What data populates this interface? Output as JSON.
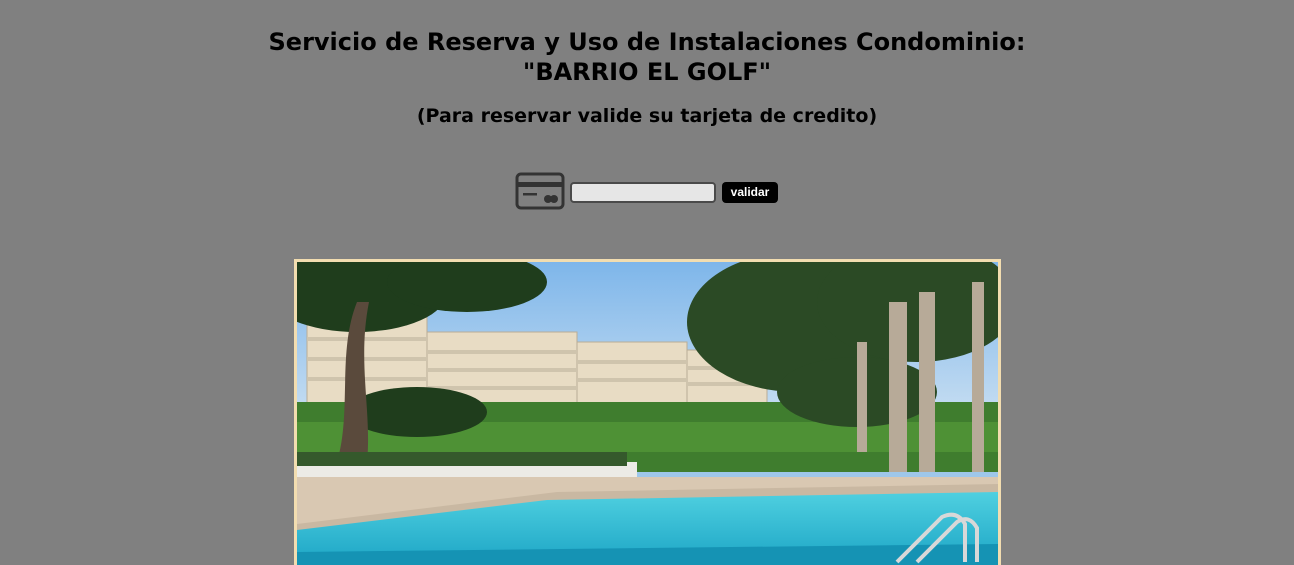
{
  "header": {
    "title_line1": "Servicio de Reserva y Uso de Instalaciones Condominio:",
    "title_line2": "\"BARRIO EL GOLF\"",
    "subtitle": "(Para reservar valide su tarjeta de credito)"
  },
  "validation": {
    "icon": "credit-card-icon",
    "input_value": "",
    "input_placeholder": "",
    "button_label": "validar"
  },
  "hero_image": {
    "subject": "condominium-pool-photo"
  },
  "colors": {
    "page_background": "#808080",
    "button_background": "#000000",
    "button_text": "#ffffff",
    "image_border": "#f2ddb0"
  }
}
